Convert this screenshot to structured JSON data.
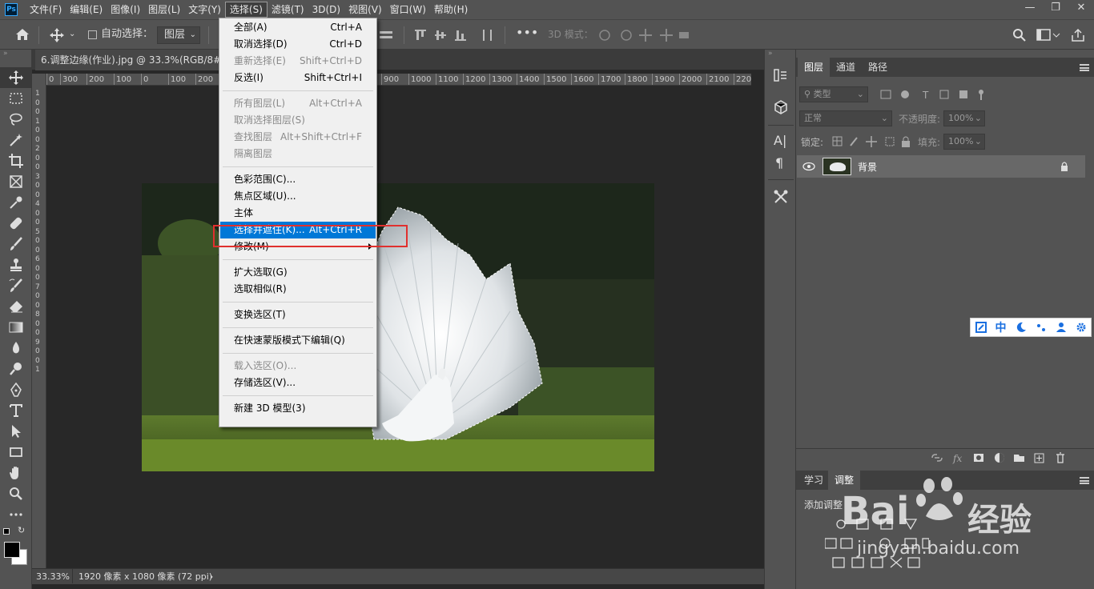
{
  "app_logo": "Ps",
  "menubar": {
    "items": [
      "文件(F)",
      "编辑(E)",
      "图像(I)",
      "图层(L)",
      "文字(Y)",
      "选择(S)",
      "滤镜(T)",
      "3D(D)",
      "视图(V)",
      "窗口(W)",
      "帮助(H)"
    ],
    "active_index": 5
  },
  "options_bar": {
    "auto_select_label": "自动选择：",
    "auto_select_value": "图层",
    "mode_3d_label": "3D 模式："
  },
  "document": {
    "tab_title": "6.调整边缘(作业).jpg @ 33.3%(RGB/8#)",
    "tab_close": "×"
  },
  "ruler_h_labels": [
    "0",
    "300",
    "200",
    "100",
    "0",
    "100",
    "200",
    "900",
    "1000",
    "1100",
    "1200",
    "1300",
    "1400",
    "1500",
    "1600",
    "1700",
    "1800",
    "1900",
    "2000",
    "2100",
    "2200"
  ],
  "ruler_v_labels": [
    "1",
    "0",
    "0",
    "1",
    "0",
    "0",
    "2",
    "0",
    "0",
    "3",
    "0",
    "0",
    "4",
    "0",
    "0",
    "5",
    "0",
    "0",
    "6",
    "0",
    "0",
    "7",
    "0",
    "0",
    "8",
    "0",
    "0",
    "9",
    "0",
    "0",
    "1"
  ],
  "status": {
    "zoom": "33.33%",
    "doc_info": "1920 像素 x 1080 像素 (72 ppi)",
    "arrow": "›"
  },
  "select_menu": {
    "groups": [
      [
        {
          "label": "全部(A)",
          "shortcut": "Ctrl+A",
          "disabled": false
        },
        {
          "label": "取消选择(D)",
          "shortcut": "Ctrl+D",
          "disabled": false
        },
        {
          "label": "重新选择(E)",
          "shortcut": "Shift+Ctrl+D",
          "disabled": true
        },
        {
          "label": "反选(I)",
          "shortcut": "Shift+Ctrl+I",
          "disabled": false
        }
      ],
      [
        {
          "label": "所有图层(L)",
          "shortcut": "Alt+Ctrl+A",
          "disabled": true
        },
        {
          "label": "取消选择图层(S)",
          "shortcut": "",
          "disabled": true
        },
        {
          "label": "查找图层",
          "shortcut": "Alt+Shift+Ctrl+F",
          "disabled": true
        },
        {
          "label": "隔离图层",
          "shortcut": "",
          "disabled": true
        }
      ],
      [
        {
          "label": "色彩范围(C)...",
          "shortcut": "",
          "disabled": false
        },
        {
          "label": "焦点区域(U)...",
          "shortcut": "",
          "disabled": false
        },
        {
          "label": "主体",
          "shortcut": "",
          "disabled": false
        },
        {
          "label": "选择并遮住(K)...",
          "shortcut": "Alt+Ctrl+R",
          "disabled": false,
          "highlighted": true
        },
        {
          "label": "修改(M)",
          "shortcut": "",
          "disabled": false,
          "submenu": true
        }
      ],
      [
        {
          "label": "扩大选取(G)",
          "shortcut": "",
          "disabled": false
        },
        {
          "label": "选取相似(R)",
          "shortcut": "",
          "disabled": false
        }
      ],
      [
        {
          "label": "变换选区(T)",
          "shortcut": "",
          "disabled": false
        }
      ],
      [
        {
          "label": "在快速蒙版模式下编辑(Q)",
          "shortcut": "",
          "disabled": false
        }
      ],
      [
        {
          "label": "载入选区(O)...",
          "shortcut": "",
          "disabled": true
        },
        {
          "label": "存储选区(V)...",
          "shortcut": "",
          "disabled": false
        }
      ],
      [
        {
          "label": "新建 3D 模型(3)",
          "shortcut": "",
          "disabled": false
        }
      ]
    ]
  },
  "layers_panel": {
    "tabs": [
      "图层",
      "通道",
      "路径"
    ],
    "active_tab": "图层",
    "kind_filter": "类型",
    "blend_mode": "正常",
    "opacity_label": "不透明度:",
    "opacity_value": "100%",
    "lock_label": "锁定:",
    "fill_label": "填充:",
    "fill_value": "100%",
    "layers": [
      {
        "name": "背景",
        "visible": true,
        "locked": true
      }
    ]
  },
  "adjust_panel": {
    "tabs": [
      "学习",
      "调整"
    ],
    "active_tab": "调整",
    "heading": "添加调整"
  },
  "ime_bar": {
    "items": [
      "中"
    ]
  },
  "watermark": {
    "brand": "Bai",
    "brand2": "经验",
    "url": "jingyan.baidu.com"
  },
  "colors": {
    "ui_bg": "#535353",
    "canvas_bg": "#282828",
    "menu_highlight": "#0078d7",
    "callout_red": "#e0302e",
    "ime_blue": "#1a6fe0"
  }
}
